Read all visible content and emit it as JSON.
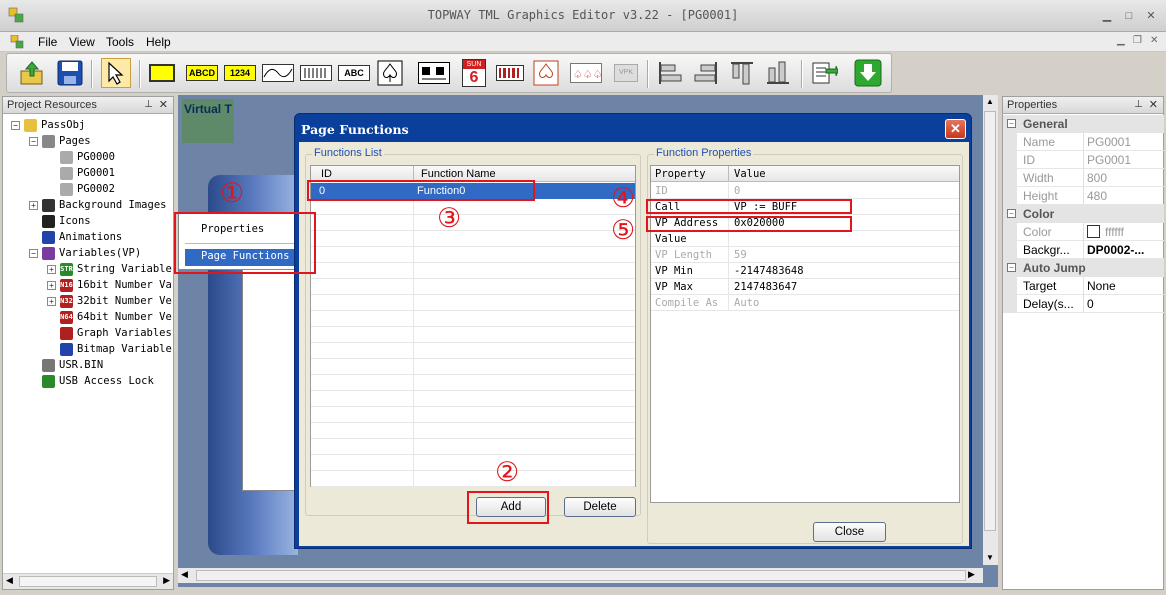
{
  "window": {
    "title": "TOPWAY TML Graphics Editor v3.22 - [PG0001]"
  },
  "menu": [
    "File",
    "View",
    "Tools",
    "Help"
  ],
  "toolbar_icons": [
    "open-icon",
    "save-icon",
    "pointer-tool-icon",
    "rectangle-tool-icon",
    "text-tool-icon",
    "number-tool-icon",
    "graph-tool-icon",
    "bitmap-variable-tool-icon",
    "abc-label-tool-icon",
    "touch-icon",
    "animation-icon",
    "calendar-icon",
    "barcode-icon",
    "spade-icon",
    "cards-icon",
    "vpk-icon",
    "align-left-icon",
    "align-right-icon",
    "align-top-icon",
    "align-bottom-icon",
    "export-icon",
    "download-icon"
  ],
  "calendar_icon": {
    "month": "SUN",
    "day": "6"
  },
  "project_panel": {
    "title": "Project Resources",
    "tree": [
      {
        "label": "PassObj",
        "level": 0,
        "expander": "⊟",
        "icon": "folder-icon"
      },
      {
        "label": "Pages",
        "level": 1,
        "expander": "⊟",
        "icon": "pages-icon"
      },
      {
        "label": "PG0000",
        "level": 2,
        "icon": "page-icon"
      },
      {
        "label": "PG0001",
        "level": 2,
        "icon": "page-icon"
      },
      {
        "label": "PG0002",
        "level": 2,
        "icon": "page-icon"
      },
      {
        "label": "Background Images",
        "level": 1,
        "expander": "⊞",
        "icon": "background-images-icon"
      },
      {
        "label": "Icons",
        "level": 1,
        "icon": "icons-icon"
      },
      {
        "label": "Animations",
        "level": 1,
        "icon": "animations-icon"
      },
      {
        "label": "Variables(VP)",
        "level": 1,
        "expander": "⊟",
        "icon": "variables-icon"
      },
      {
        "label": "String Variables",
        "level": 2,
        "expander": "⊞",
        "icon": "string-variable-icon",
        "badge": "STR"
      },
      {
        "label": "16bit Number Va",
        "level": 2,
        "expander": "⊞",
        "icon": "n16-icon",
        "badge": "N16"
      },
      {
        "label": "32bit Number Ve",
        "level": 2,
        "expander": "⊞",
        "icon": "n32-icon",
        "badge": "N32"
      },
      {
        "label": "64bit Number Ve",
        "level": 2,
        "icon": "n64-icon",
        "badge": "N64"
      },
      {
        "label": "Graph Variables",
        "level": 2,
        "icon": "graph-variable-icon"
      },
      {
        "label": "Bitmap Variable",
        "level": 2,
        "icon": "bitmap-variable-icon"
      },
      {
        "label": "USR.BIN",
        "level": 1,
        "icon": "bin-file-icon"
      },
      {
        "label": "USB Access Lock",
        "level": 1,
        "icon": "usb-lock-icon"
      }
    ]
  },
  "canvas": {
    "tab_label": "Virtual T"
  },
  "context_menu": {
    "items": [
      "Properties",
      "Page Functions"
    ]
  },
  "dialog": {
    "title": "Page Functions",
    "functions_list": {
      "label": "Functions List",
      "columns": [
        "ID",
        "Function Name"
      ],
      "rows": [
        {
          "id": "0",
          "name": "Function0"
        }
      ]
    },
    "function_properties": {
      "label": "Function Properties",
      "columns": [
        "Property",
        "Value"
      ],
      "rows": [
        {
          "property": "ID",
          "value": "0",
          "disabled": true
        },
        {
          "property": "Call",
          "value": "VP := BUFF",
          "disabled": false
        },
        {
          "property": "VP Address",
          "value": "0x020000",
          "disabled": false
        },
        {
          "property": "Value",
          "value": "",
          "disabled": false
        },
        {
          "property": "VP Length",
          "value": "59",
          "disabled": true
        },
        {
          "property": "VP Min",
          "value": "-2147483648",
          "disabled": false
        },
        {
          "property": "VP Max",
          "value": "2147483647",
          "disabled": false
        },
        {
          "property": "Compile As",
          "value": "Auto",
          "disabled": true
        }
      ]
    },
    "buttons": {
      "add": "Add",
      "delete": "Delete",
      "close": "Close"
    }
  },
  "annotations": {
    "one": "①",
    "two": "②",
    "three": "③",
    "four": "④",
    "five": "⑤"
  },
  "properties_panel": {
    "title": "Properties",
    "sections": [
      {
        "name": "General",
        "rows": [
          {
            "key": "Name",
            "value": "PG0001",
            "dim": true
          },
          {
            "key": "ID",
            "value": "PG0001",
            "dim": true
          },
          {
            "key": "Width",
            "value": "800",
            "dim": true
          },
          {
            "key": "Height",
            "value": "480",
            "dim": true
          }
        ]
      },
      {
        "name": "Color",
        "rows": [
          {
            "key": "Color",
            "value": "ffffff",
            "dim": true,
            "swatch": "#ffffff"
          },
          {
            "key": "Backgr...",
            "value": "DP0002-...",
            "dim": false,
            "bold": true
          }
        ]
      },
      {
        "name": "Auto Jump",
        "rows": [
          {
            "key": "Target",
            "value": "None",
            "dim": false
          },
          {
            "key": "Delay(s...",
            "value": "0",
            "dim": false
          }
        ]
      }
    ]
  },
  "colors": {
    "annotation_red": "#e0161c",
    "dialog_blue": "#0a3f9c",
    "selection_blue": "#316ac5"
  }
}
